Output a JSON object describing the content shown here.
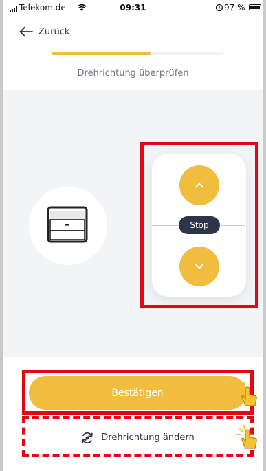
{
  "status_bar": {
    "carrier": "Telekom.de",
    "time": "09:31",
    "battery": "97 %"
  },
  "header": {
    "back_label": "Zurück",
    "progress_fraction": 0.58,
    "title": "Drehrichtung überprüfen"
  },
  "remote": {
    "up_icon": "chevron-up-icon",
    "stop_label": "Stop",
    "down_icon": "chevron-down-icon"
  },
  "device_icon": "garage-door-icon",
  "actions": {
    "confirm_label": "Bestätigen",
    "change_direction_label": "Drehrichtung ändern",
    "change_direction_icon": "rotate-icon"
  },
  "colors": {
    "accent": "#f1bd3f",
    "dark": "#2d3548",
    "annotation": "#e30613",
    "background_grey": "#f3f4f6"
  }
}
